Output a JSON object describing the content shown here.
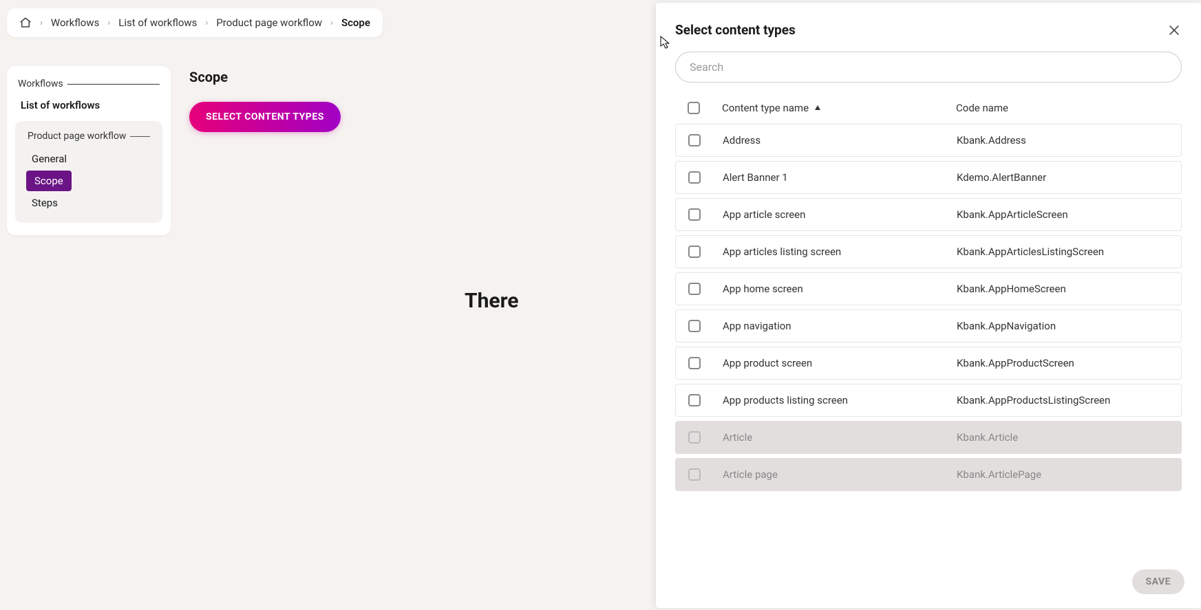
{
  "breadcrumb": {
    "items": [
      "Workflows",
      "List of workflows",
      "Product page workflow",
      "Scope"
    ]
  },
  "sidebar": {
    "heading": "Workflows",
    "list_link": "List of workflows",
    "sub_header": "Product page workflow",
    "items": [
      "General",
      "Scope",
      "Steps"
    ],
    "active_index": 1
  },
  "main": {
    "title": "Scope",
    "button_label": "SELECT CONTENT TYPES",
    "empty_text_partial": "There"
  },
  "panel": {
    "title": "Select content types",
    "search_placeholder": "Search",
    "columns": {
      "name": "Content type name",
      "code": "Code name"
    },
    "rows": [
      {
        "name": "Address",
        "code": "Kbank.Address",
        "disabled": false
      },
      {
        "name": "Alert Banner 1",
        "code": "Kdemo.AlertBanner",
        "disabled": false
      },
      {
        "name": "App article screen",
        "code": "Kbank.AppArticleScreen",
        "disabled": false
      },
      {
        "name": "App articles listing screen",
        "code": "Kbank.AppArticlesListingScreen",
        "disabled": false
      },
      {
        "name": "App home screen",
        "code": "Kbank.AppHomeScreen",
        "disabled": false
      },
      {
        "name": "App navigation",
        "code": "Kbank.AppNavigation",
        "disabled": false
      },
      {
        "name": "App product screen",
        "code": "Kbank.AppProductScreen",
        "disabled": false
      },
      {
        "name": "App products listing screen",
        "code": "Kbank.AppProductsListingScreen",
        "disabled": false
      },
      {
        "name": "Article",
        "code": "Kbank.Article",
        "disabled": true
      },
      {
        "name": "Article page",
        "code": "Kbank.ArticlePage",
        "disabled": true
      }
    ],
    "save_label": "SAVE"
  }
}
